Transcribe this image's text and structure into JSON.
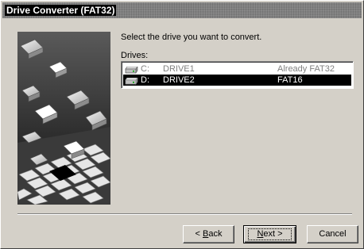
{
  "window": {
    "title": "Drive Converter (FAT32)"
  },
  "main": {
    "instruction": "Select the drive you want to convert.",
    "drives_label": "Drives:"
  },
  "drives": [
    {
      "letter": "C:",
      "name": "DRIVE1",
      "status": "Already FAT32",
      "icon": "hard-drive-icon",
      "selected": false
    },
    {
      "letter": "D:",
      "name": "DRIVE2",
      "status": "FAT16",
      "icon": "hard-drive-icon",
      "selected": true
    }
  ],
  "buttons": {
    "back": {
      "pre": "< ",
      "key": "B",
      "post": "ack"
    },
    "next": {
      "key": "N",
      "post": "ext >"
    },
    "cancel": "Cancel"
  },
  "colors": {
    "face": "#d4d0c8",
    "selection": "#000000",
    "selection_text": "#ffffff",
    "disabled_text": "#808080"
  }
}
